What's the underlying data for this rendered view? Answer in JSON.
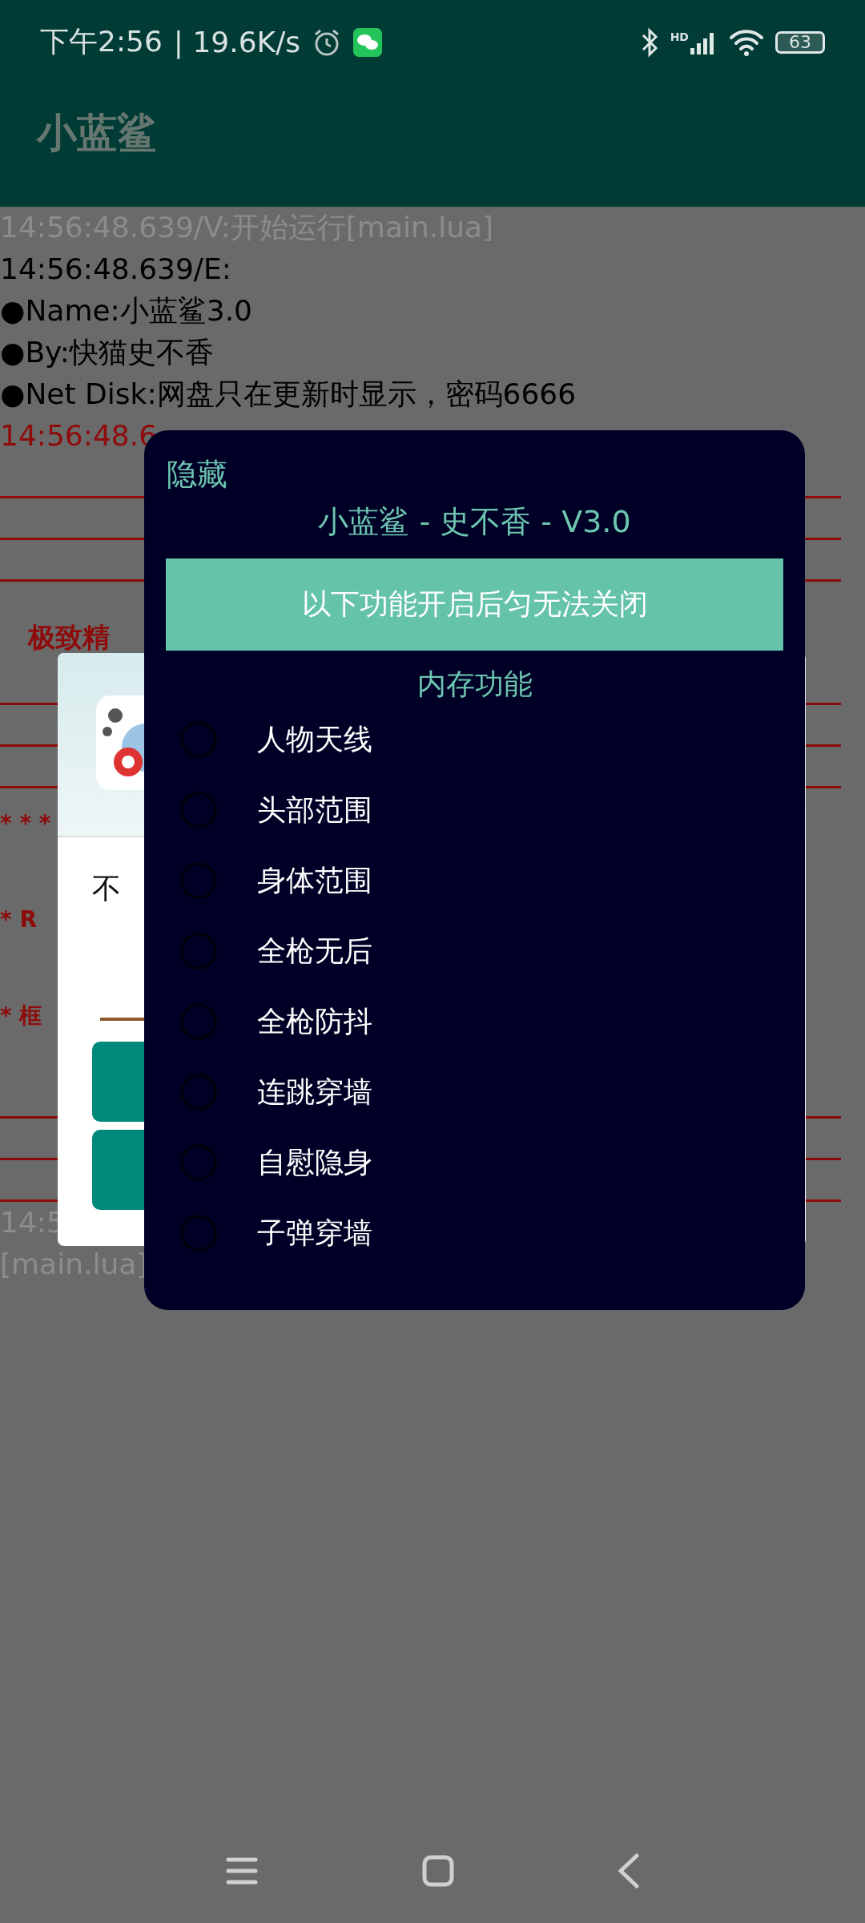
{
  "status_bar": {
    "time": "下午2:56",
    "speed": "| 19.6K/s",
    "signal_label": "HD",
    "battery": "63"
  },
  "app_bar": {
    "title": "小蓝鲨"
  },
  "log": [
    {
      "kind": "verbose",
      "text": "14:56:48.639/V:开始运行[main.lua]"
    },
    {
      "kind": "plain",
      "text": "14:56:48.639/E:"
    },
    {
      "kind": "plain",
      "text": "●Name:小蓝鲨3.0"
    },
    {
      "kind": "plain",
      "text": "●By:快猫史不香"
    },
    {
      "kind": "plain",
      "text": "●Net Disk:网盘只在更新时显示，密码6666"
    },
    {
      "kind": "error",
      "text": "14:56:48.6"
    },
    {
      "kind": "rule"
    },
    {
      "kind": "rule"
    },
    {
      "kind": "rule"
    },
    {
      "kind": "heading",
      "text": "极致精"
    },
    {
      "kind": "rule"
    },
    {
      "kind": "rule"
    },
    {
      "kind": "rule"
    },
    {
      "kind": "note",
      "text": "* * *"
    },
    {
      "kind": "note",
      "text": "* R"
    },
    {
      "kind": "note",
      "text": "* 框"
    },
    {
      "kind": "rule"
    },
    {
      "kind": "rule"
    },
    {
      "kind": "rule"
    },
    {
      "kind": "verbose",
      "text": "14:5"
    },
    {
      "kind": "verbose",
      "text": "[main.lua]"
    }
  ],
  "dialog": {
    "message": "不"
  },
  "menu": {
    "hide_label": "隐藏",
    "title": "小蓝鲨 - 史不香 - V3.0",
    "banner": "以下功能开启后匀无法关闭",
    "section": "内存功能",
    "items": [
      {
        "label": "人物天线",
        "checked": false
      },
      {
        "label": "头部范围",
        "checked": false
      },
      {
        "label": "身体范围",
        "checked": false
      },
      {
        "label": "全枪无后",
        "checked": false
      },
      {
        "label": "全枪防抖",
        "checked": false
      },
      {
        "label": "连跳穿墙",
        "checked": false
      },
      {
        "label": "自慰隐身",
        "checked": false
      },
      {
        "label": "子弹穿墙",
        "checked": false
      }
    ]
  }
}
